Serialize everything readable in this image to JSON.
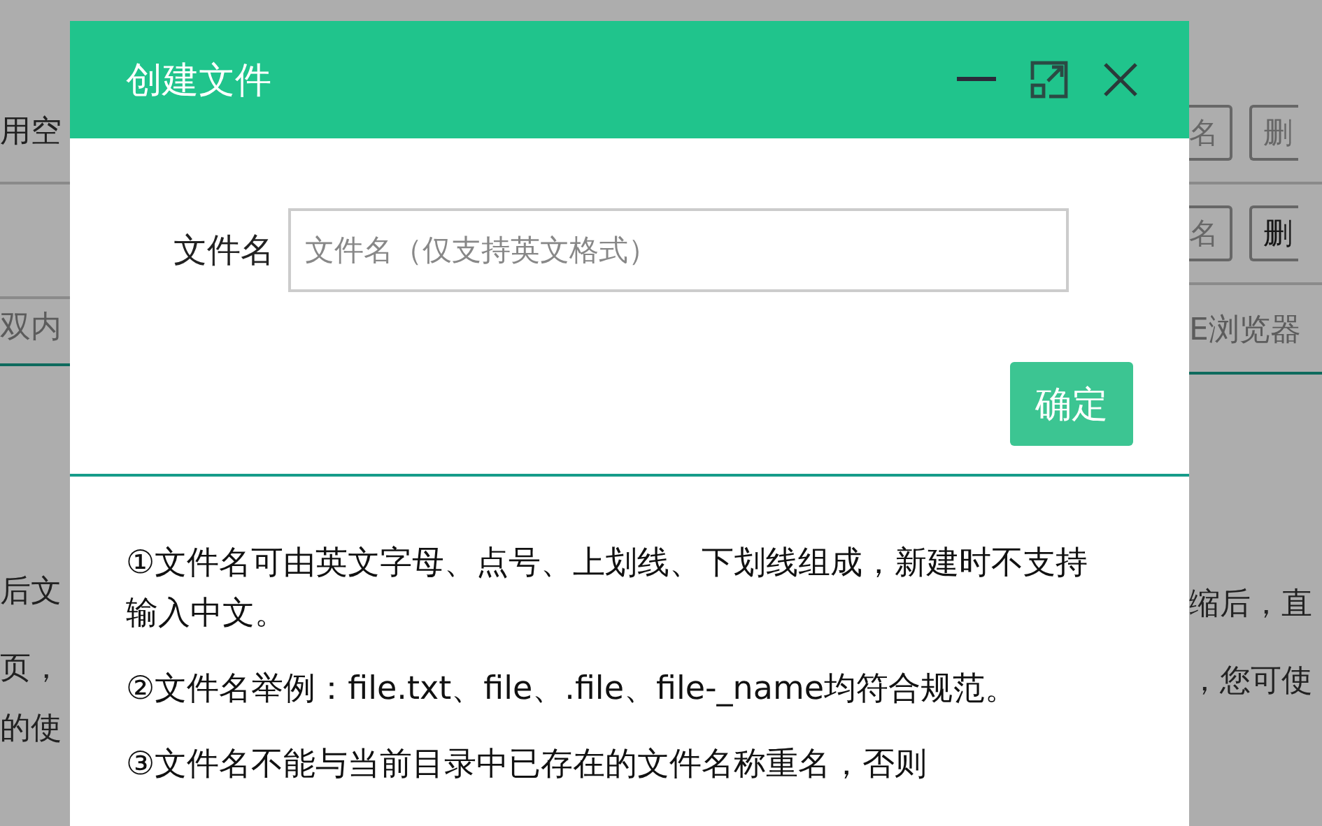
{
  "background": {
    "left_texts": [
      {
        "text": "用空",
        "kind": "dark"
      },
      {
        "text": "双内",
        "kind": "muted"
      },
      {
        "text": "后文",
        "kind": "dark"
      },
      {
        "text": "页，",
        "kind": "dark"
      },
      {
        "text": "的使",
        "kind": "dark"
      }
    ],
    "right_rows": [
      {
        "buttons": [
          {
            "label": "名",
            "disabled": true
          },
          {
            "label": "删",
            "disabled": true
          }
        ]
      },
      {
        "buttons": [
          {
            "label": "名",
            "disabled": true
          },
          {
            "label": "删",
            "disabled": false
          }
        ]
      }
    ],
    "right_texts": [
      {
        "text": "E浏览器",
        "kind": "muted"
      },
      {
        "text": "缩后，直",
        "kind": "dark"
      },
      {
        "text": "，您可使",
        "kind": "dark"
      }
    ]
  },
  "dialog": {
    "title": "创建文件",
    "field": {
      "label": "文件名",
      "placeholder": "文件名（仅支持英文格式）"
    },
    "confirm_button": "确定",
    "notes": [
      "①文件名可由英文字母、点号、上划线、下划线组成，新建时不支持输入中文。",
      "②文件名举例：file.txt、file、.file、file-_name均符合规范。",
      "③文件名不能与当前目录中已存在的文件名称重名，否则"
    ]
  }
}
